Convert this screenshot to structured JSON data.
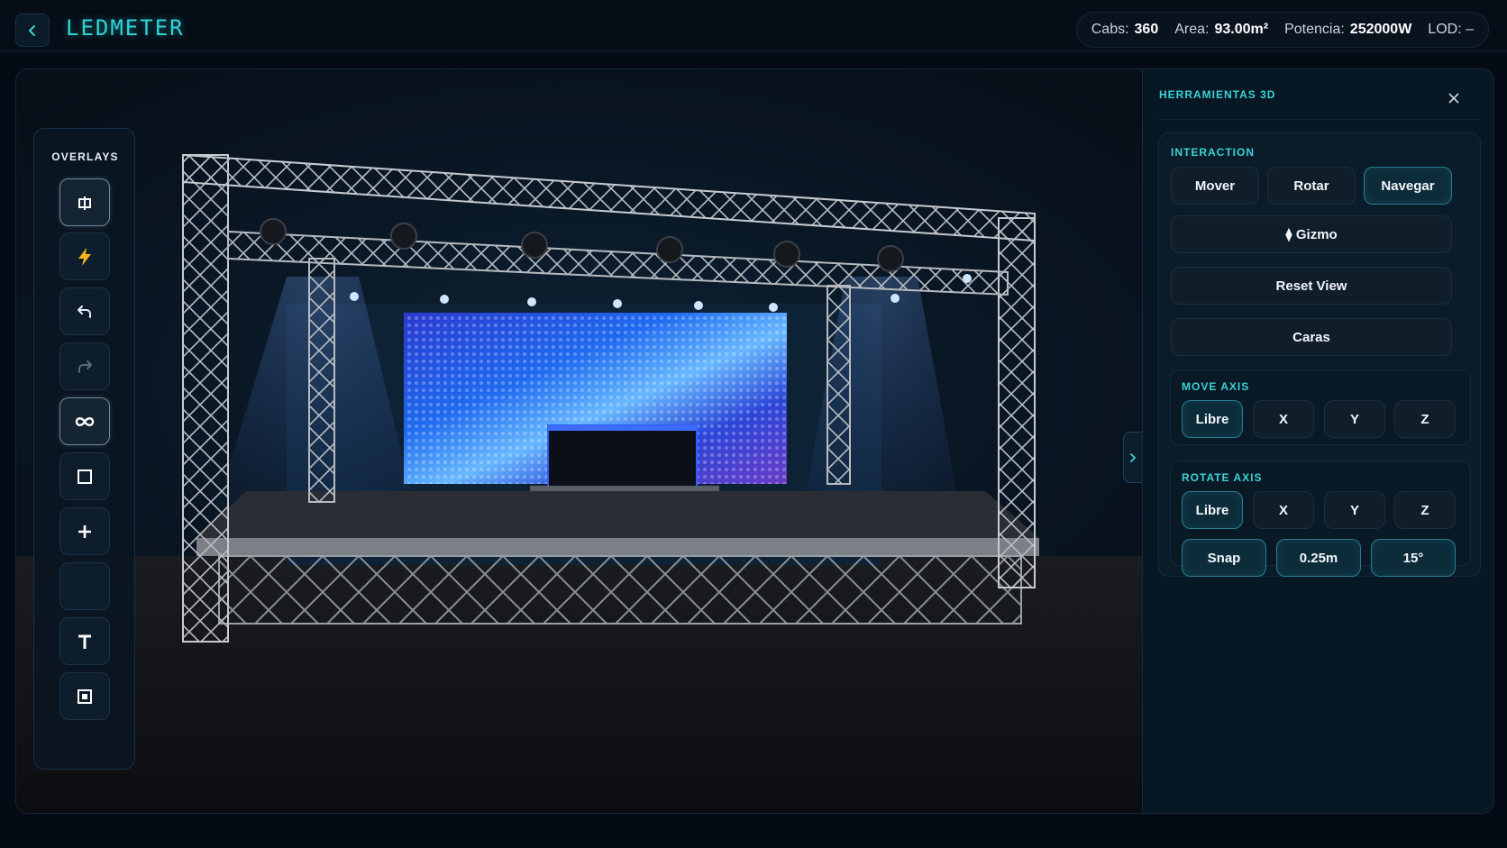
{
  "header": {
    "back_icon": "chevron-left-icon",
    "app_title": "LEDMETER",
    "stats": [
      {
        "label": "Cabs:",
        "value": "360"
      },
      {
        "label": "Area:",
        "value": "93.00m²"
      },
      {
        "label": "Potencia:",
        "value": "252000W"
      },
      {
        "label": "LOD:",
        "value": "–"
      }
    ]
  },
  "overlays": {
    "title": "OVERLAYS",
    "tools": [
      {
        "icon": "panel-split-icon",
        "active": true
      },
      {
        "icon": "lightning-icon",
        "active": false
      },
      {
        "icon": "undo-icon",
        "active": false
      },
      {
        "icon": "redo-icon",
        "active": false
      },
      {
        "icon": "infinity-icon",
        "active": true
      },
      {
        "icon": "square-icon",
        "active": false
      },
      {
        "icon": "plus-icon",
        "active": false
      },
      {
        "icon": "blank-tool",
        "active": false
      },
      {
        "icon": "text-icon",
        "active": false
      },
      {
        "icon": "frame-icon",
        "active": false
      }
    ]
  },
  "panel": {
    "title": "HERRAMIENTAS 3D",
    "interaction": {
      "label": "INTERACTION",
      "modes": [
        "Mover",
        "Rotar",
        "Navegar"
      ],
      "selected_mode": "Navegar",
      "gizmo": "⧫ Gizmo",
      "reset_view": "Reset View",
      "caras": "Caras"
    },
    "move_axis": {
      "label": "MOVE AXIS",
      "options": [
        "Libre",
        "X",
        "Y",
        "Z"
      ],
      "selected": "Libre"
    },
    "rotate_axis": {
      "label": "ROTATE AXIS",
      "options": [
        "Libre",
        "X",
        "Y",
        "Z"
      ],
      "selected": "Libre",
      "snap": "Snap",
      "snap_distance": "0.25m",
      "snap_angle": "15°"
    }
  },
  "colors": {
    "accent": "#3ad3d6",
    "background": "#050b14",
    "panel": "#081724"
  }
}
